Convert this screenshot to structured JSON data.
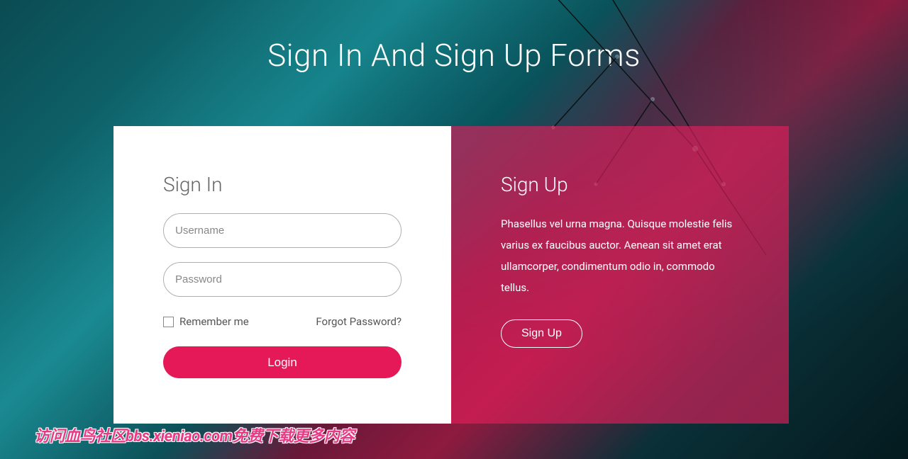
{
  "page_title": "Sign In And Sign Up Forms",
  "signin": {
    "heading": "Sign In",
    "username_placeholder": "Username",
    "password_placeholder": "Password",
    "remember_label": "Remember me",
    "forgot_label": "Forgot Password?",
    "login_button": "Login"
  },
  "signup": {
    "heading": "Sign Up",
    "description": "Phasellus vel urna magna. Quisque molestie felis varius ex faucibus auctor. Aenean sit amet erat ullamcorper, condimentum odio in, commodo tellus.",
    "button": "Sign Up"
  },
  "footer_text": "访问血鸟社区bbs.xieniao.com免费下载更多内容"
}
